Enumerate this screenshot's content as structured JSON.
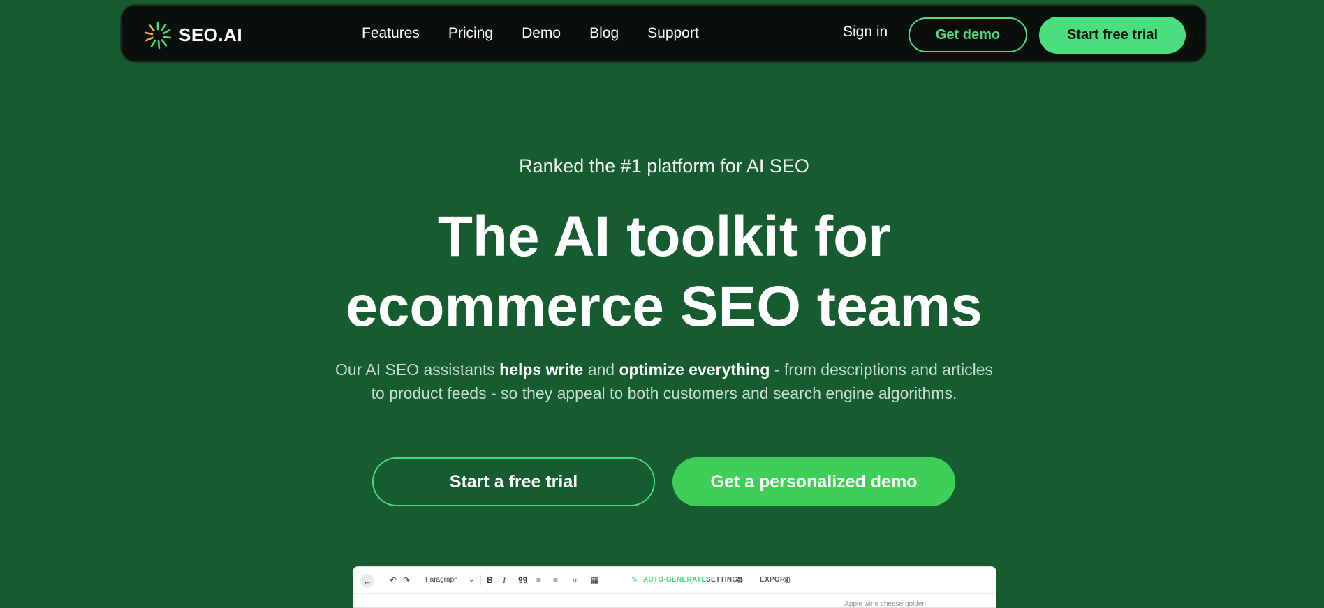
{
  "nav": {
    "logo_text": "SEO.AI",
    "links": [
      "Features",
      "Pricing",
      "Demo",
      "Blog",
      "Support"
    ],
    "signin": "Sign in",
    "get_demo": "Get demo",
    "start_trial": "Start free trial"
  },
  "hero": {
    "eyebrow": "Ranked the #1 platform for AI SEO",
    "title_line1": "The AI toolkit for",
    "title_line2": "ecommerce SEO teams",
    "sub": {
      "p1": "Our AI SEO assistants ",
      "b1": "helps write",
      "p2": " and ",
      "b2": "optimize everything",
      "p3": " - from descriptions and articles",
      "line2": "to product feeds - so they appeal to both customers and search engine algorithms."
    },
    "cta_trial": "Start a free trial",
    "cta_demo": "Get a personalized demo"
  },
  "editor": {
    "paragraph": "Paragraph",
    "bold": "B",
    "italic": "I",
    "quote": "99",
    "auto_generate": "AUTO-GENERATE",
    "settings": "SETTINGS",
    "export": "EXPORT",
    "meta": "Apple wine cheese golden"
  },
  "colors": {
    "background": "#175b31",
    "navbar": "#0b0f0c",
    "accent": "#4cdd7f",
    "cta": "#3fcf58"
  },
  "icons": [
    "sunburst-logo-icon",
    "back-arrow-icon",
    "undo-icon",
    "redo-icon",
    "chevron-down-icon",
    "bullet-list-icon",
    "numbered-list-icon",
    "link-icon",
    "table-icon",
    "pencil-icon",
    "gear-icon",
    "copy-icon"
  ]
}
